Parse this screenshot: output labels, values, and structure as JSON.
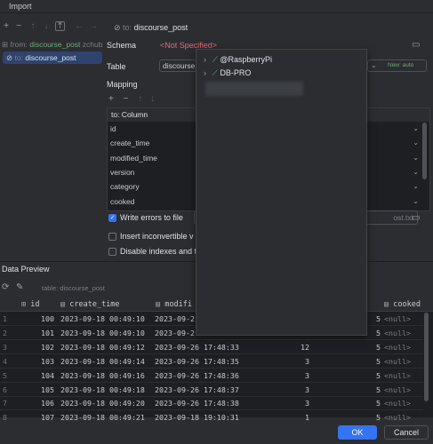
{
  "window": {
    "title": "Import"
  },
  "left": {
    "from_label": "from:",
    "from_table": "discourse_post",
    "from_schema": "zchub",
    "to_label": "to:",
    "to_table": "discourse_post"
  },
  "header": {
    "to_label": "to:",
    "to_table": "discourse_post"
  },
  "form": {
    "schema_label": "Schema",
    "schema_value": "<Not Specified>",
    "table_label": "Table",
    "table_value": "discourse",
    "new_badge": "New: auto",
    "mapping_label": "Mapping",
    "to_column_header": "to: Column",
    "columns": [
      "id",
      "create_time",
      "modified_time",
      "version",
      "category",
      "cooked"
    ]
  },
  "options": {
    "write_errors": "Write errors to file",
    "write_errors_checked": true,
    "error_file_suffix": "ost.txt",
    "insert_inconvertible": "Insert inconvertible v",
    "disable_indexes": "Disable indexes and t"
  },
  "popup": {
    "items": [
      {
        "label": "@RaspberryPi"
      },
      {
        "label": "DB-PRO"
      }
    ]
  },
  "preview": {
    "title": "Data Preview",
    "table_label": "table: discourse_post",
    "columns": {
      "id": "id",
      "create_time": "create_time",
      "modified": "modifi",
      "cooked": "cooked"
    },
    "rows": [
      {
        "n": "1",
        "id": "100",
        "create": "2023-09-18 00:49:10",
        "modified": "2023-09-2",
        "v": "",
        "v2": "5",
        "cooked": "<null>"
      },
      {
        "n": "2",
        "id": "101",
        "create": "2023-09-18 00:49:10",
        "modified": "2023-09-2",
        "v": "",
        "v2": "5",
        "cooked": "<null>"
      },
      {
        "n": "3",
        "id": "102",
        "create": "2023-09-18 00:49:12",
        "modified": "2023-09-26 17:48:33",
        "v": "12",
        "v2": "5",
        "cooked": "<null>"
      },
      {
        "n": "4",
        "id": "103",
        "create": "2023-09-18 00:49:14",
        "modified": "2023-09-26 17:48:35",
        "v": "3",
        "v2": "5",
        "cooked": "<null>"
      },
      {
        "n": "5",
        "id": "104",
        "create": "2023-09-18 00:49:16",
        "modified": "2023-09-26 17:48:36",
        "v": "3",
        "v2": "5",
        "cooked": "<null>"
      },
      {
        "n": "6",
        "id": "105",
        "create": "2023-09-18 00:49:18",
        "modified": "2023-09-26 17:48:37",
        "v": "3",
        "v2": "5",
        "cooked": "<null>"
      },
      {
        "n": "7",
        "id": "106",
        "create": "2023-09-18 00:49:20",
        "modified": "2023-09-26 17:48:38",
        "v": "3",
        "v2": "5",
        "cooked": "<null>"
      },
      {
        "n": "8",
        "id": "107",
        "create": "2023-09-18 00:49:21",
        "modified": "2023-09-18 19:10:31",
        "v": "1",
        "v2": "5",
        "cooked": "<null>"
      }
    ]
  },
  "buttons": {
    "ok": "OK",
    "cancel": "Cancel"
  },
  "colors": {
    "accent": "#3574f0",
    "error": "#e06c75",
    "green": "#6aab73"
  }
}
